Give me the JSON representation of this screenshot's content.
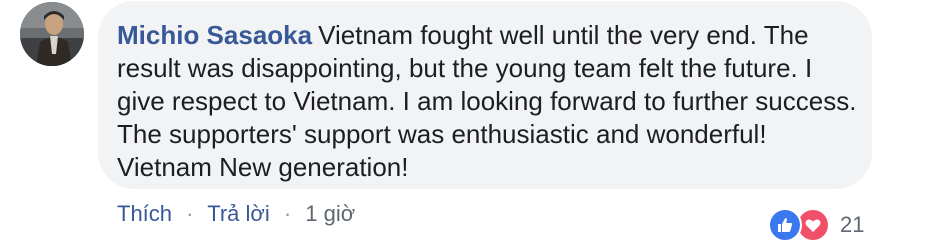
{
  "comment": {
    "author": "Michio Sasaoka",
    "text": "Vietnam fought well until the very end. The result was disappointing, but the young team felt the future. I give respect to Vietnam. I am looking forward to further success. The supporters' support was enthusiastic and wonderful! Vietnam New generation!"
  },
  "reactions": {
    "icons": [
      "like-icon",
      "love-icon"
    ],
    "count": "21",
    "like_color": "#3b78f0",
    "love_color": "#f0506a"
  },
  "actions": {
    "like_label": "Thích",
    "separator": "·",
    "reply_label": "Trả lời",
    "time": "1 giờ"
  },
  "colors": {
    "author": "#385898",
    "bubble": "#f2f3f5",
    "text": "#1c1e21"
  }
}
